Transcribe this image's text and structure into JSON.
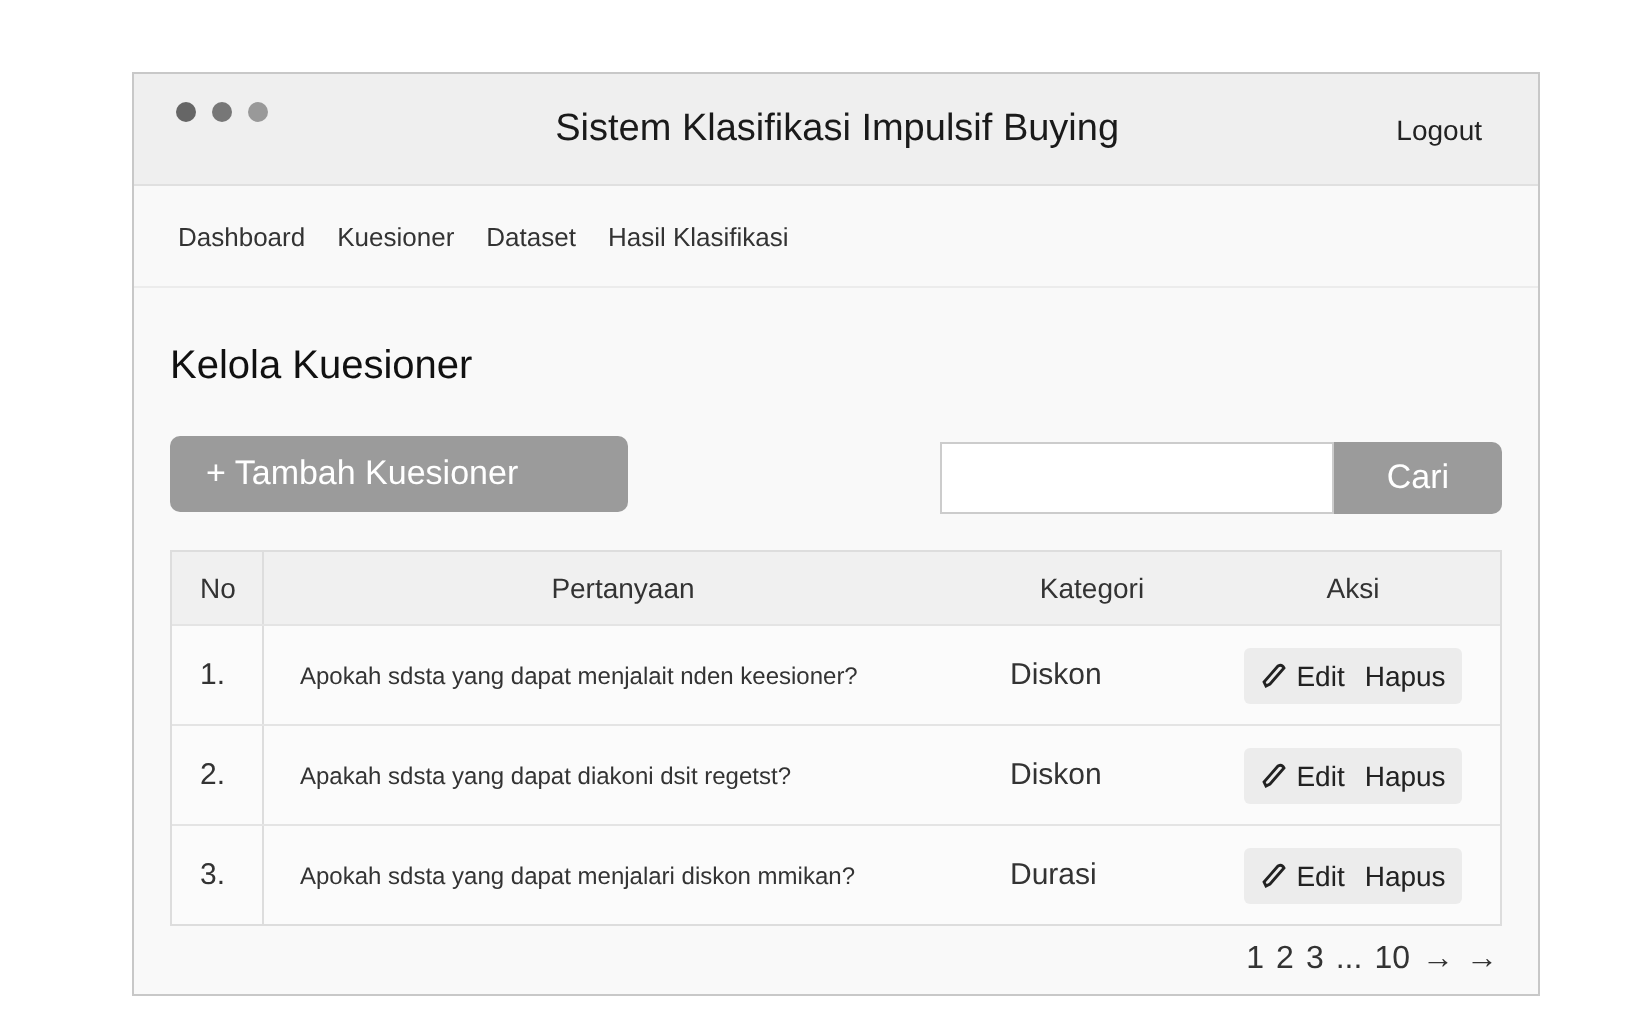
{
  "window": {
    "title": "Sistem Klasifikasi Impulsif Buying",
    "logout": "Logout"
  },
  "nav": [
    {
      "label": "Dashboard"
    },
    {
      "label": "Kuesioner"
    },
    {
      "label": "Dataset"
    },
    {
      "label": "Hasil Klasifikasi"
    }
  ],
  "page_title": "Kelola Kuesioner",
  "add_button": {
    "icon": "+",
    "label": "Tambah Kuesioner"
  },
  "search": {
    "button": "Cari"
  },
  "table": {
    "columns": [
      "No",
      "Pertanyaan",
      "Kategori",
      "Aksi"
    ],
    "rows": [
      {
        "no": "1.",
        "question": "Apokah sdsta yang dapat menjalait nden keesioner?",
        "category": "Diskon",
        "edit": "Edit",
        "delete": "Hapus"
      },
      {
        "no": "2.",
        "question": "Apakah sdsta yang dapat diakoni dsit regetst?",
        "category": "Diskon",
        "edit": "Edit",
        "delete": "Hapus"
      },
      {
        "no": "3.",
        "question": "Apokah sdsta yang dapat menjalari diskon mmikan?",
        "category": "Durasi",
        "edit": "Edit",
        "delete": "Hapus"
      }
    ]
  },
  "pagination": [
    "1",
    "2",
    "3",
    "...",
    "10",
    "→",
    "→"
  ]
}
